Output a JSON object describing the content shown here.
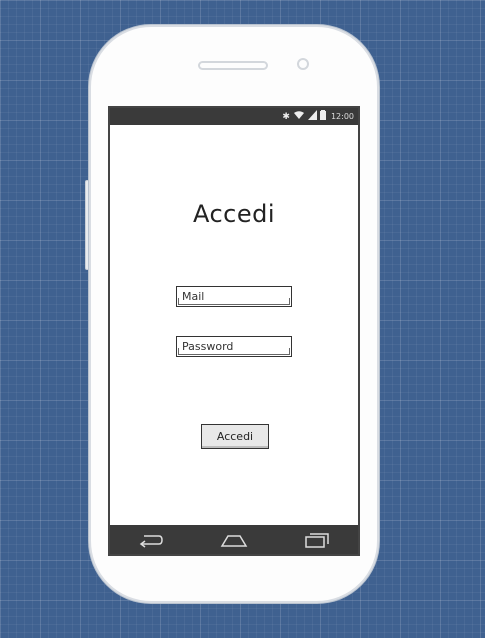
{
  "status_bar": {
    "time": "12:00",
    "icons": [
      "bluetooth-icon",
      "wifi-icon",
      "signal-icon",
      "battery-icon"
    ]
  },
  "screen": {
    "title": "Accedi",
    "mail_placeholder": "Mail",
    "password_placeholder": "Password",
    "login_label": "Accedi"
  },
  "nav_bar": {
    "icons": [
      "back-icon",
      "home-icon",
      "recent-apps-icon"
    ]
  }
}
